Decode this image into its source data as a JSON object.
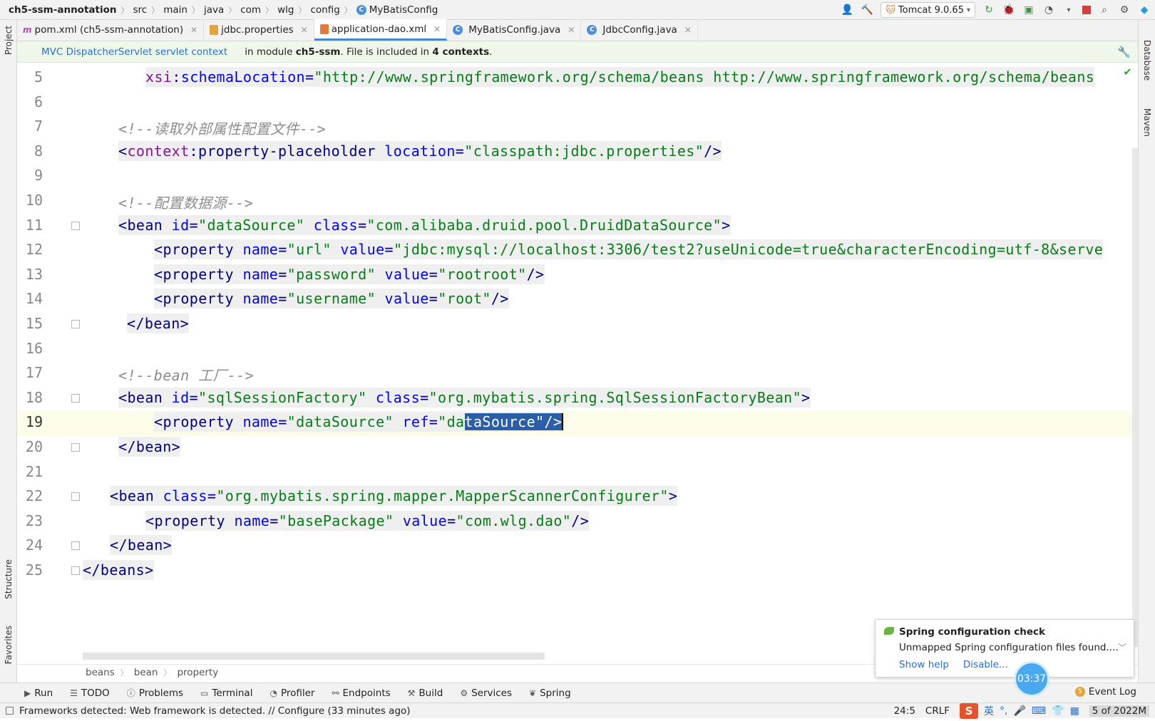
{
  "breadcrumb": [
    "ch5-ssm-annotation",
    "src",
    "main",
    "java",
    "com",
    "wlg",
    "config",
    "MyBatisConfig"
  ],
  "run_config": "Tomcat 9.0.65",
  "tabs": [
    {
      "label": "pom.xml (ch5-ssm-annotation)",
      "icon": "maven-icon"
    },
    {
      "label": "jdbc.properties",
      "icon": "properties-file-icon"
    },
    {
      "label": "application-dao.xml",
      "icon": "xml-file-icon",
      "active": true
    },
    {
      "label": "MyBatisConfig.java",
      "icon": "class-icon"
    },
    {
      "label": "JdbcConfig.java",
      "icon": "class-icon"
    }
  ],
  "banner": {
    "link": "MVC DispatcherServlet servlet context",
    "prefix": "in module ",
    "module": "ch5-ssm",
    "middle": ". File is included in ",
    "contexts": "4 contexts",
    "suffix": "."
  },
  "side_labels": {
    "project": "Project",
    "structure": "Structure",
    "favorites": "Favorites",
    "database": "Database",
    "maven": "Maven"
  },
  "code_lines": [
    {
      "n": "5",
      "parts": [
        [
          "ns",
          "xsi"
        ],
        [
          "p",
          ":"
        ],
        [
          "a",
          "schemaLocation"
        ],
        [
          "p",
          "="
        ],
        [
          "v",
          "\"http://www.springframework.org/schema/beans http://www.springframework.org/schema/beans"
        ]
      ]
    },
    {
      "n": "6",
      "parts": []
    },
    {
      "n": "7",
      "parts": [
        [
          "c",
          "<!--读取外部属性配置文件-->"
        ]
      ]
    },
    {
      "n": "8",
      "parts": [
        [
          "p",
          "<"
        ],
        [
          "ns",
          "context"
        ],
        [
          "p",
          ":"
        ],
        [
          "t",
          "property-placeholder "
        ],
        [
          "a",
          "location"
        ],
        [
          "p",
          "="
        ],
        [
          "v",
          "\"classpath:jdbc.properties\""
        ],
        [
          "p",
          "/>"
        ]
      ]
    },
    {
      "n": "9",
      "parts": []
    },
    {
      "n": "10",
      "parts": [
        [
          "c",
          "<!--配置数据源-->"
        ]
      ]
    },
    {
      "n": "11",
      "parts": [
        [
          "p",
          "<"
        ],
        [
          "t",
          "bean "
        ],
        [
          "a",
          "id"
        ],
        [
          "p",
          "="
        ],
        [
          "v",
          "\"dataSource\" "
        ],
        [
          "a",
          "class"
        ],
        [
          "p",
          "="
        ],
        [
          "v",
          "\"com.alibaba.druid.pool.DruidDataSource\""
        ],
        [
          "p",
          ">"
        ]
      ]
    },
    {
      "n": "12",
      "parts": [
        [
          "p",
          "<"
        ],
        [
          "t",
          "property "
        ],
        [
          "a",
          "name"
        ],
        [
          "p",
          "="
        ],
        [
          "v",
          "\"url\" "
        ],
        [
          "a",
          "value"
        ],
        [
          "p",
          "="
        ],
        [
          "v",
          "\"jdbc:mysql://localhost:3306/test2?useUnicode=true&characterEncoding=utf-8&serve"
        ]
      ]
    },
    {
      "n": "13",
      "parts": [
        [
          "p",
          "<"
        ],
        [
          "t",
          "property "
        ],
        [
          "a",
          "name"
        ],
        [
          "p",
          "="
        ],
        [
          "v",
          "\"password\" "
        ],
        [
          "a",
          "value"
        ],
        [
          "p",
          "="
        ],
        [
          "v",
          "\"rootroot\""
        ],
        [
          "p",
          "/>"
        ]
      ]
    },
    {
      "n": "14",
      "parts": [
        [
          "p",
          "<"
        ],
        [
          "t",
          "property "
        ],
        [
          "a",
          "name"
        ],
        [
          "p",
          "="
        ],
        [
          "v",
          "\"username\" "
        ],
        [
          "a",
          "value"
        ],
        [
          "p",
          "="
        ],
        [
          "v",
          "\"root\""
        ],
        [
          "p",
          "/>"
        ]
      ]
    },
    {
      "n": "15",
      "parts": [
        [
          "p",
          "</"
        ],
        [
          "t",
          "bean"
        ],
        [
          "p",
          ">"
        ]
      ]
    },
    {
      "n": "16",
      "parts": []
    },
    {
      "n": "17",
      "parts": [
        [
          "c",
          "<!--bean 工厂-->"
        ]
      ]
    },
    {
      "n": "18",
      "parts": [
        [
          "p",
          "<"
        ],
        [
          "t",
          "bean "
        ],
        [
          "a",
          "id"
        ],
        [
          "p",
          "="
        ],
        [
          "v",
          "\"sqlSessionFactory\" "
        ],
        [
          "a",
          "class"
        ],
        [
          "p",
          "="
        ],
        [
          "v",
          "\"org.mybatis.spring.SqlSessionFactoryBean\""
        ],
        [
          "p",
          ">"
        ]
      ]
    },
    {
      "n": "19",
      "parts": [
        [
          "p",
          "<"
        ],
        [
          "t",
          "property "
        ],
        [
          "a",
          "name"
        ],
        [
          "p",
          "="
        ],
        [
          "v",
          "\"dataSource\" "
        ],
        [
          "a",
          "ref"
        ],
        [
          "p",
          "="
        ],
        [
          "v",
          "\"da"
        ],
        [
          "sel",
          "taSource\"/>"
        ]
      ]
    },
    {
      "n": "20",
      "parts": [
        [
          "p",
          "</"
        ],
        [
          "t",
          "bean"
        ],
        [
          "p",
          ">"
        ]
      ]
    },
    {
      "n": "21",
      "parts": []
    },
    {
      "n": "22",
      "parts": [
        [
          "p",
          "<"
        ],
        [
          "t",
          "bean "
        ],
        [
          "a",
          "class"
        ],
        [
          "p",
          "="
        ],
        [
          "v",
          "\"org.mybatis.spring.mapper.MapperScannerConfigurer\""
        ],
        [
          "p",
          ">"
        ]
      ]
    },
    {
      "n": "23",
      "parts": [
        [
          "p",
          "<"
        ],
        [
          "t",
          "property "
        ],
        [
          "a",
          "name"
        ],
        [
          "p",
          "="
        ],
        [
          "v",
          "\"basePackage\" "
        ],
        [
          "a",
          "value"
        ],
        [
          "p",
          "="
        ],
        [
          "v",
          "\"com.wlg.dao\""
        ],
        [
          "p",
          "/>"
        ]
      ]
    },
    {
      "n": "24",
      "parts": [
        [
          "p",
          "</"
        ],
        [
          "t",
          "bean"
        ],
        [
          "p",
          ">"
        ]
      ]
    },
    {
      "n": "25",
      "parts": [
        [
          "p",
          "</"
        ],
        [
          "t",
          "beans"
        ],
        [
          "p",
          ">"
        ]
      ]
    }
  ],
  "xml_path": [
    "beans",
    "bean",
    "property"
  ],
  "tool_windows": [
    {
      "label": "Run",
      "icon": "play-icon"
    },
    {
      "label": "TODO",
      "icon": "list-icon"
    },
    {
      "label": "Problems",
      "icon": "info-icon"
    },
    {
      "label": "Terminal",
      "icon": "terminal-icon"
    },
    {
      "label": "Profiler",
      "icon": "profiler-icon"
    },
    {
      "label": "Endpoints",
      "icon": "endpoints-icon"
    },
    {
      "label": "Build",
      "icon": "hammer-icon"
    },
    {
      "label": "Services",
      "icon": "services-icon"
    },
    {
      "label": "Spring",
      "icon": "spring-icon"
    }
  ],
  "event_log": {
    "count": "5",
    "label": "Event Log"
  },
  "status": {
    "message": "Frameworks detected: Web framework is detected. // Configure (33 minutes ago)",
    "position": "24:5",
    "line_ending": "CRLF",
    "ime_label": "英",
    "memory": "5 of 2022M"
  },
  "notification": {
    "title": "Spring configuration check",
    "body": "Unmapped Spring configuration files found....",
    "show_help": "Show help",
    "disable": "Disable..."
  },
  "timer": "03:37",
  "colors": {
    "tag": "#000080",
    "attr": "#0000ff",
    "value": "#067d17",
    "namespace": "#871094",
    "comment": "#8c8c8c",
    "selection": "#2a5fa8",
    "accent": "#4a88c7"
  }
}
